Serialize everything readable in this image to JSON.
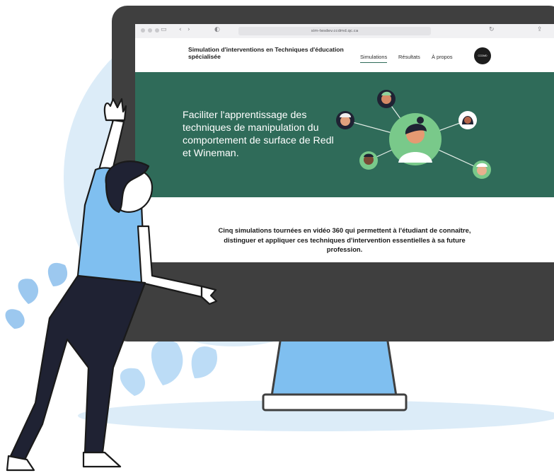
{
  "browser": {
    "url": "sim-tesdev.ccdmd.qc.ca"
  },
  "site": {
    "title": "Simulation d'interventions en Techniques d'éducation spécialisée",
    "nav": [
      {
        "label": "Simulations",
        "active": true
      },
      {
        "label": "Résultats",
        "active": false
      },
      {
        "label": "À propos",
        "active": false
      }
    ],
    "logo": "CCDMD"
  },
  "hero": {
    "text": "Faciliter l'apprentissage des techniques de manipulation du comportement de surface de Redl et Wineman."
  },
  "intro": {
    "text": "Cinq simulations tournées en vidéo 360 qui permettent à l'étudiant de connaître, distinguer et appliquer ces techniques d'intervention essentielles à sa future profession."
  },
  "colors": {
    "hero_green": "#2f6b59",
    "accent_green": "#79c98a",
    "monitor_dark": "#3f3f3f",
    "backdrop_blue": "#dcecf8"
  }
}
